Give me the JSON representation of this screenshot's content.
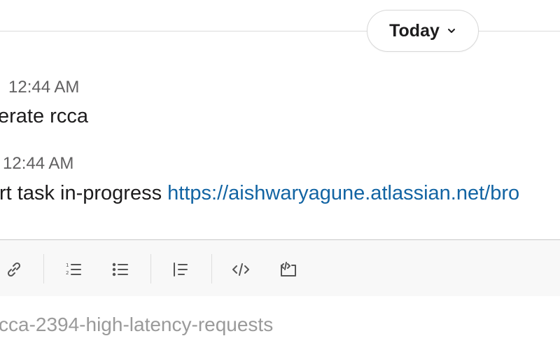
{
  "divider": {
    "day_label": "Today",
    "chevron_icon": "chevron-down-icon"
  },
  "messages": [
    {
      "timestamp": "12:44 AM",
      "text": "erate rcca"
    },
    {
      "timestamp": "12:44 AM",
      "text": "rt task in-progress ",
      "link": "https://aishwaryagune.atlassian.net/bro"
    }
  ],
  "composer": {
    "toolbar_icons": [
      "link-icon",
      "ordered-list-icon",
      "bulleted-list-icon",
      "blockquote-icon",
      "code-icon",
      "code-block-icon"
    ],
    "draft_text": "cca-2394-high-latency-requests"
  },
  "colors": {
    "link": "#1264a3",
    "timestamp": "#616061",
    "text": "#1d1c1d"
  }
}
